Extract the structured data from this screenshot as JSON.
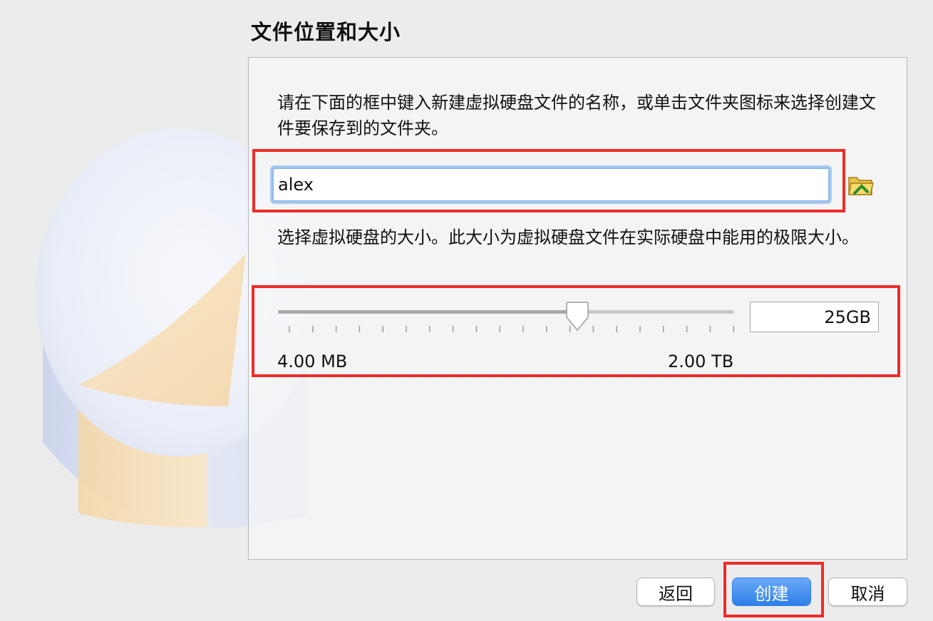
{
  "page_title": "文件位置和大小",
  "location": {
    "description": "请在下面的框中键入新建虚拟硬盘文件的名称，或单击文件夹图标来选择创建文件要保存到的文件夹。",
    "file_name_value": "alex",
    "folder_icon": "folder-icon"
  },
  "size": {
    "description": "选择虚拟硬盘的大小。此大小为虚拟硬盘文件在实际硬盘中能用的极限大小。",
    "value": "25GB",
    "min_label": "4.00 MB",
    "max_label": "2.00 TB",
    "slider_fraction": 0.66
  },
  "buttons": {
    "back": "返回",
    "create": "创建",
    "cancel": "取消"
  },
  "colors": {
    "accent": "#2f7fe8",
    "highlight_box": "#ed2c2a"
  }
}
